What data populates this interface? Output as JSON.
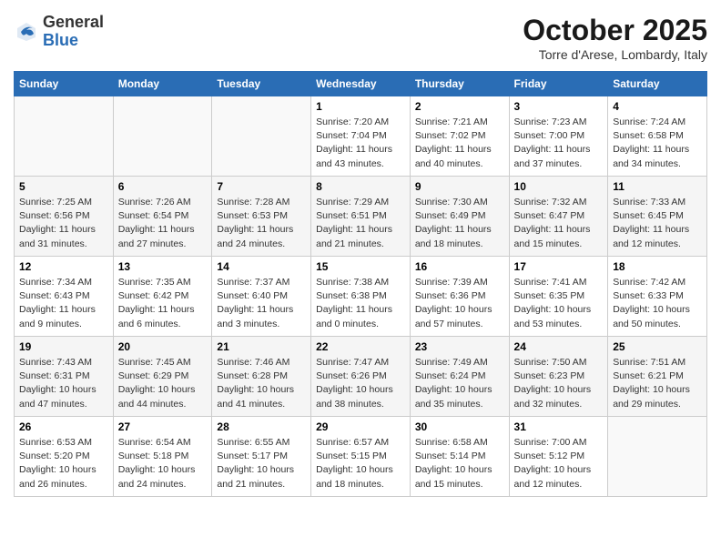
{
  "logo": {
    "general": "General",
    "blue": "Blue"
  },
  "title": "October 2025",
  "subtitle": "Torre d'Arese, Lombardy, Italy",
  "weekdays": [
    "Sunday",
    "Monday",
    "Tuesday",
    "Wednesday",
    "Thursday",
    "Friday",
    "Saturday"
  ],
  "weeks": [
    [
      {
        "day": "",
        "info": ""
      },
      {
        "day": "",
        "info": ""
      },
      {
        "day": "",
        "info": ""
      },
      {
        "day": "1",
        "info": "Sunrise: 7:20 AM\nSunset: 7:04 PM\nDaylight: 11 hours and 43 minutes."
      },
      {
        "day": "2",
        "info": "Sunrise: 7:21 AM\nSunset: 7:02 PM\nDaylight: 11 hours and 40 minutes."
      },
      {
        "day": "3",
        "info": "Sunrise: 7:23 AM\nSunset: 7:00 PM\nDaylight: 11 hours and 37 minutes."
      },
      {
        "day": "4",
        "info": "Sunrise: 7:24 AM\nSunset: 6:58 PM\nDaylight: 11 hours and 34 minutes."
      }
    ],
    [
      {
        "day": "5",
        "info": "Sunrise: 7:25 AM\nSunset: 6:56 PM\nDaylight: 11 hours and 31 minutes."
      },
      {
        "day": "6",
        "info": "Sunrise: 7:26 AM\nSunset: 6:54 PM\nDaylight: 11 hours and 27 minutes."
      },
      {
        "day": "7",
        "info": "Sunrise: 7:28 AM\nSunset: 6:53 PM\nDaylight: 11 hours and 24 minutes."
      },
      {
        "day": "8",
        "info": "Sunrise: 7:29 AM\nSunset: 6:51 PM\nDaylight: 11 hours and 21 minutes."
      },
      {
        "day": "9",
        "info": "Sunrise: 7:30 AM\nSunset: 6:49 PM\nDaylight: 11 hours and 18 minutes."
      },
      {
        "day": "10",
        "info": "Sunrise: 7:32 AM\nSunset: 6:47 PM\nDaylight: 11 hours and 15 minutes."
      },
      {
        "day": "11",
        "info": "Sunrise: 7:33 AM\nSunset: 6:45 PM\nDaylight: 11 hours and 12 minutes."
      }
    ],
    [
      {
        "day": "12",
        "info": "Sunrise: 7:34 AM\nSunset: 6:43 PM\nDaylight: 11 hours and 9 minutes."
      },
      {
        "day": "13",
        "info": "Sunrise: 7:35 AM\nSunset: 6:42 PM\nDaylight: 11 hours and 6 minutes."
      },
      {
        "day": "14",
        "info": "Sunrise: 7:37 AM\nSunset: 6:40 PM\nDaylight: 11 hours and 3 minutes."
      },
      {
        "day": "15",
        "info": "Sunrise: 7:38 AM\nSunset: 6:38 PM\nDaylight: 11 hours and 0 minutes."
      },
      {
        "day": "16",
        "info": "Sunrise: 7:39 AM\nSunset: 6:36 PM\nDaylight: 10 hours and 57 minutes."
      },
      {
        "day": "17",
        "info": "Sunrise: 7:41 AM\nSunset: 6:35 PM\nDaylight: 10 hours and 53 minutes."
      },
      {
        "day": "18",
        "info": "Sunrise: 7:42 AM\nSunset: 6:33 PM\nDaylight: 10 hours and 50 minutes."
      }
    ],
    [
      {
        "day": "19",
        "info": "Sunrise: 7:43 AM\nSunset: 6:31 PM\nDaylight: 10 hours and 47 minutes."
      },
      {
        "day": "20",
        "info": "Sunrise: 7:45 AM\nSunset: 6:29 PM\nDaylight: 10 hours and 44 minutes."
      },
      {
        "day": "21",
        "info": "Sunrise: 7:46 AM\nSunset: 6:28 PM\nDaylight: 10 hours and 41 minutes."
      },
      {
        "day": "22",
        "info": "Sunrise: 7:47 AM\nSunset: 6:26 PM\nDaylight: 10 hours and 38 minutes."
      },
      {
        "day": "23",
        "info": "Sunrise: 7:49 AM\nSunset: 6:24 PM\nDaylight: 10 hours and 35 minutes."
      },
      {
        "day": "24",
        "info": "Sunrise: 7:50 AM\nSunset: 6:23 PM\nDaylight: 10 hours and 32 minutes."
      },
      {
        "day": "25",
        "info": "Sunrise: 7:51 AM\nSunset: 6:21 PM\nDaylight: 10 hours and 29 minutes."
      }
    ],
    [
      {
        "day": "26",
        "info": "Sunrise: 6:53 AM\nSunset: 5:20 PM\nDaylight: 10 hours and 26 minutes."
      },
      {
        "day": "27",
        "info": "Sunrise: 6:54 AM\nSunset: 5:18 PM\nDaylight: 10 hours and 24 minutes."
      },
      {
        "day": "28",
        "info": "Sunrise: 6:55 AM\nSunset: 5:17 PM\nDaylight: 10 hours and 21 minutes."
      },
      {
        "day": "29",
        "info": "Sunrise: 6:57 AM\nSunset: 5:15 PM\nDaylight: 10 hours and 18 minutes."
      },
      {
        "day": "30",
        "info": "Sunrise: 6:58 AM\nSunset: 5:14 PM\nDaylight: 10 hours and 15 minutes."
      },
      {
        "day": "31",
        "info": "Sunrise: 7:00 AM\nSunset: 5:12 PM\nDaylight: 10 hours and 12 minutes."
      },
      {
        "day": "",
        "info": ""
      }
    ]
  ]
}
